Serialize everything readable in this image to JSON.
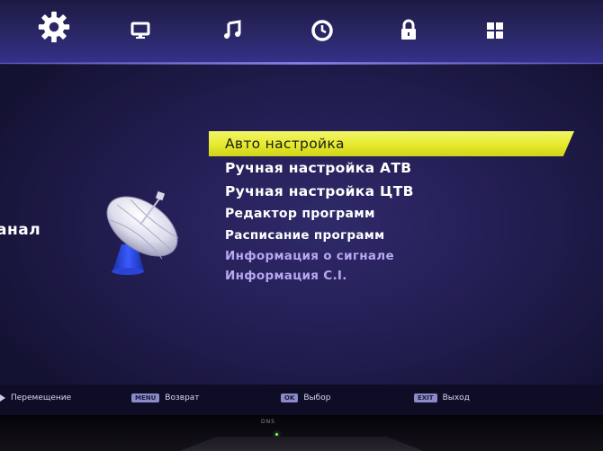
{
  "tabs": [
    {
      "icon": "gear-icon",
      "selected": true
    },
    {
      "icon": "monitor-icon",
      "selected": false
    },
    {
      "icon": "music-note-icon",
      "selected": false
    },
    {
      "icon": "clock-icon",
      "selected": false
    },
    {
      "icon": "lock-icon",
      "selected": false
    },
    {
      "icon": "windows-grid-icon",
      "selected": false
    }
  ],
  "side_label": "анал",
  "menu": {
    "items": [
      {
        "label": "Авто настройка",
        "state": "selected"
      },
      {
        "label": "Ручная настройка АТВ",
        "state": "normal"
      },
      {
        "label": "Ручная настройка ЦТВ",
        "state": "normal"
      },
      {
        "label": "Редактор программ",
        "state": "normal"
      },
      {
        "label": "Расписание программ",
        "state": "normal"
      },
      {
        "label": "Информация о сигнале",
        "state": "disabled"
      },
      {
        "label": "Информация C.I.",
        "state": "disabled"
      }
    ]
  },
  "footer": {
    "move": {
      "label": "Перемещение"
    },
    "back": {
      "key": "MENU",
      "label": "Возврат"
    },
    "select": {
      "key": "OK",
      "label": "Выбор"
    },
    "exit": {
      "key": "EXIT",
      "label": "Выход"
    }
  },
  "bezel": {
    "brand": "DNS"
  },
  "colors": {
    "highlight": "#e6ea2c",
    "background": "#241f55",
    "disabled_text": "#b7a6f0"
  }
}
